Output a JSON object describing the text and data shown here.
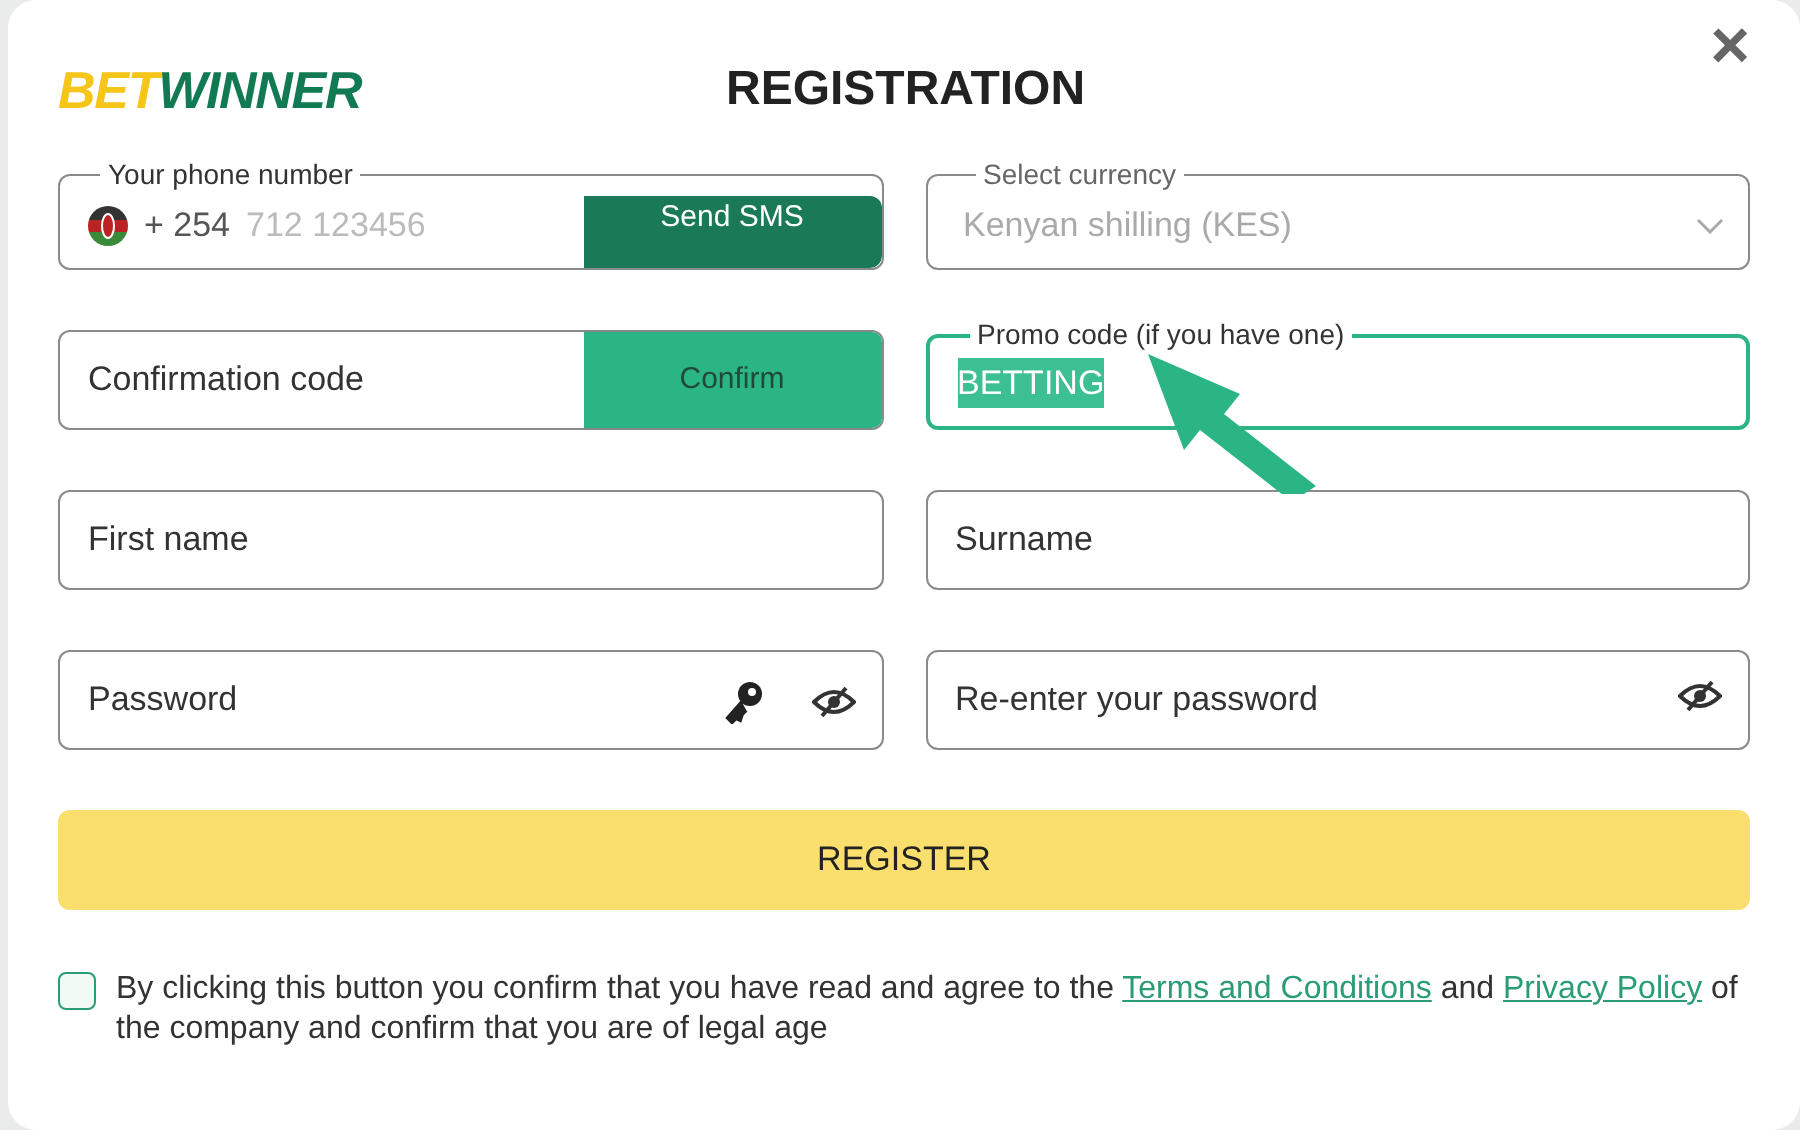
{
  "logo": {
    "part_1": "BET",
    "part_2": "WINNER"
  },
  "title": "REGISTRATION",
  "close": "×",
  "phone": {
    "label": "Your phone number",
    "prefix": "+ 254",
    "placeholder": "712 123456",
    "button": "Send SMS"
  },
  "currency": {
    "label": "Select currency",
    "value": "Kenyan shilling (KES)",
    "disabled": true
  },
  "confirmation": {
    "placeholder": "Confirmation code",
    "button": "Confirm"
  },
  "promo": {
    "label": "Promo code (if you have one)",
    "value": "BETTING",
    "focused": true,
    "text_selected": true
  },
  "fields": [
    {
      "placeholder": "First name",
      "kind": "text"
    },
    {
      "placeholder": "Surname",
      "kind": "text"
    },
    {
      "placeholder": "Password",
      "kind": "password_key"
    },
    {
      "placeholder": "Re-enter your password",
      "kind": "password"
    }
  ],
  "register": "REGISTER",
  "consent": {
    "checked": false,
    "text_1": "By clicking this button you confirm that you have read and agree to the",
    "link_1": "Terms and Conditions",
    "text_2": "and",
    "link_2": "Privacy Policy",
    "text_3": "of the company and confirm that you are of legal age"
  }
}
